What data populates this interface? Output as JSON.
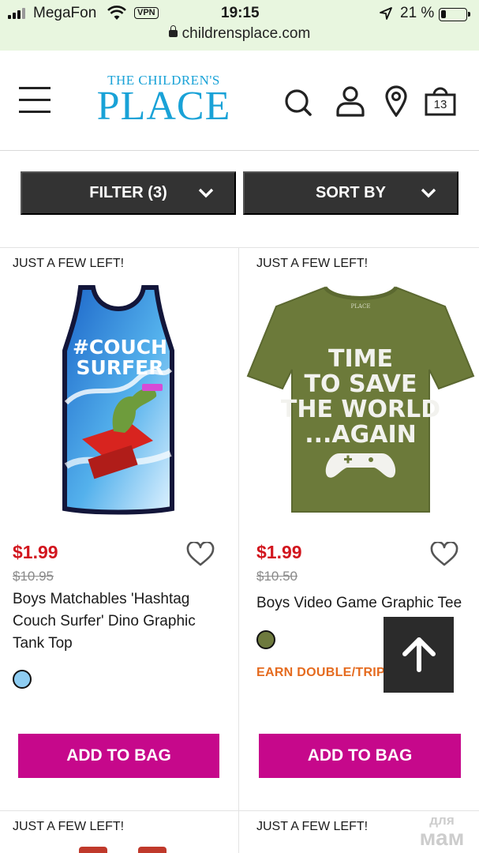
{
  "status_bar": {
    "carrier": "MegaFon",
    "vpn": "VPN",
    "time": "19:15",
    "battery_percent": "21 %",
    "battery_level": 0.21,
    "url": "childrensplace.com"
  },
  "header": {
    "logo_top": "THE CHILDREN'S",
    "logo_main": "PLACE",
    "bag_count": "13",
    "brand_color": "#19a2d7"
  },
  "controls": {
    "filter_label": "FILTER (3)",
    "sort_label": "SORT BY"
  },
  "products": [
    {
      "tag": "JUST A FEW LEFT!",
      "price": "$1.99",
      "old_price": "$10.95",
      "name_lines": [
        "Boys Matchables 'Hashtag",
        "Couch Surfer' Dino Graphic",
        "Tank Top"
      ],
      "swatch_color": "#8ecdf2",
      "image": "couch-surfer-tank-top-image",
      "image_text_1": "#COUCH",
      "image_text_2": "SURFER",
      "add_label": "ADD TO BAG"
    },
    {
      "tag": "JUST A FEW LEFT!",
      "price": "$1.99",
      "old_price": "$10.50",
      "name_lines": [
        "Boys Video Game Graphic Tee"
      ],
      "swatch_color": "#6e7a3e",
      "promo": "EARN DOUBLE/TRIP",
      "image": "video-game-tee-image",
      "image_label": "PLACE",
      "image_lines": [
        "TIME",
        "TO SAVE",
        "THE WORLD",
        "...AGAIN"
      ],
      "add_label": "ADD TO BAG"
    }
  ],
  "next_row_tags": [
    "JUST A FEW LEFT!",
    "JUST A FEW LEFT!"
  ],
  "watermark": {
    "line1": "для",
    "line2": "мам"
  },
  "colors": {
    "sale_price": "#d2161e",
    "add_to_bag": "#c6088b",
    "promo": "#e56b1f",
    "dark_button": "#333333"
  }
}
